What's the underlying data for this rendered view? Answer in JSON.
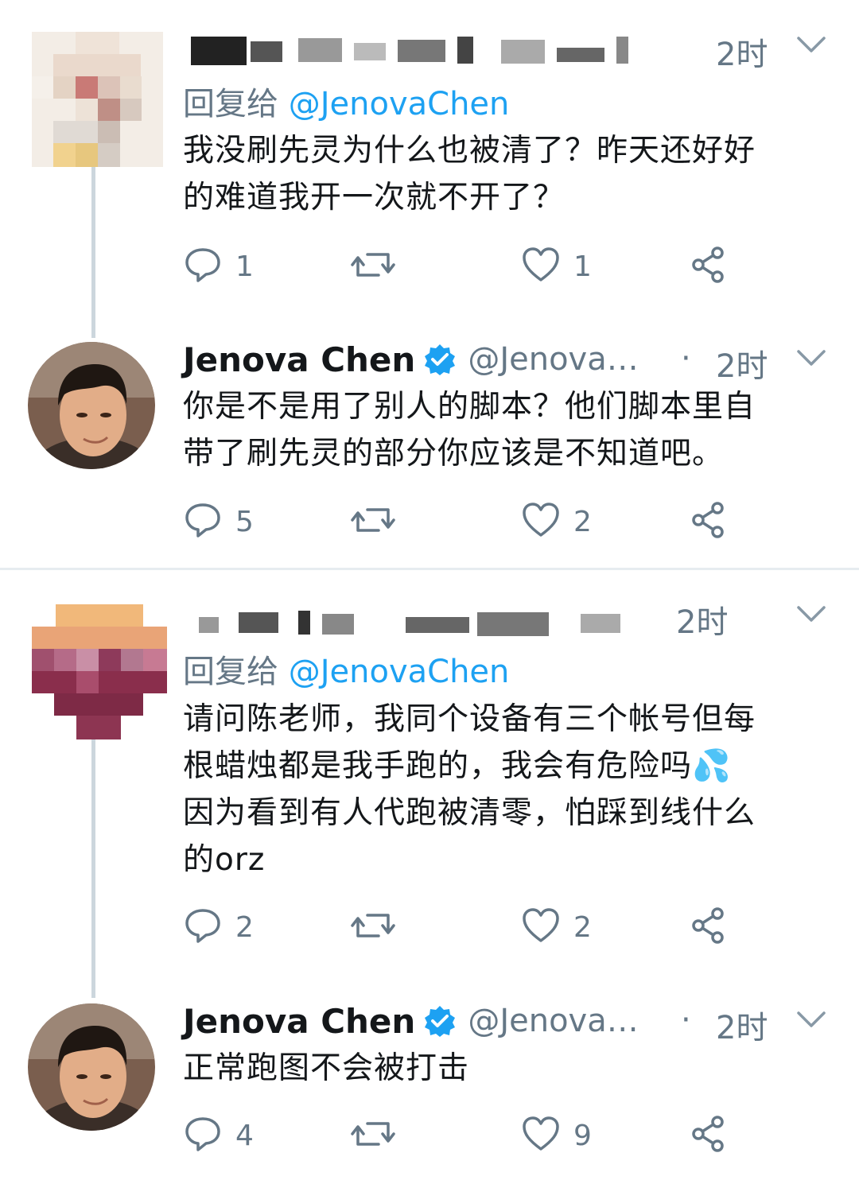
{
  "tweets": [
    {
      "time": "2时",
      "reply_prefix": "回复给",
      "reply_mention": "@JenovaChen",
      "text_lines": [
        "我没刷先灵为什么也被清了？昨天还好好",
        "的难道我开一次就不开了？"
      ],
      "reply_count": "1",
      "like_count": "1"
    },
    {
      "author": "Jenova Chen",
      "handle": "@Jenova…",
      "dot": "·",
      "time": "2时",
      "text_lines": [
        "你是不是用了别人的脚本？他们脚本里自",
        "带了刷先灵的部分你应该是不知道吧。"
      ],
      "reply_count": "5",
      "like_count": "2"
    },
    {
      "time": "2时",
      "reply_prefix": "回复给",
      "reply_mention": "@JenovaChen",
      "text_lines": [
        "请问陈老师，我同个设备有三个帐号但每",
        "根蜡烛都是我手跑的，我会有危险吗💦",
        "因为看到有人代跑被清零，怕踩到线什么",
        "的orz"
      ],
      "reply_count": "2",
      "like_count": "2"
    },
    {
      "author": "Jenova Chen",
      "handle": "@Jenova…",
      "dot": "·",
      "time": "2时",
      "text_lines": [
        "正常跑图不会被打击"
      ],
      "reply_count": "4",
      "like_count": "9"
    }
  ],
  "icons": {
    "reply": "reply-icon",
    "retweet": "retweet-icon",
    "like": "heart-icon",
    "share": "share-icon",
    "more": "chevron-down-icon",
    "verified": "verified-badge-icon"
  },
  "colors": {
    "mention": "#1da1f2",
    "secondary_text": "#657786",
    "thread_line": "#ccd6dd",
    "verified": "#1da1f2"
  }
}
